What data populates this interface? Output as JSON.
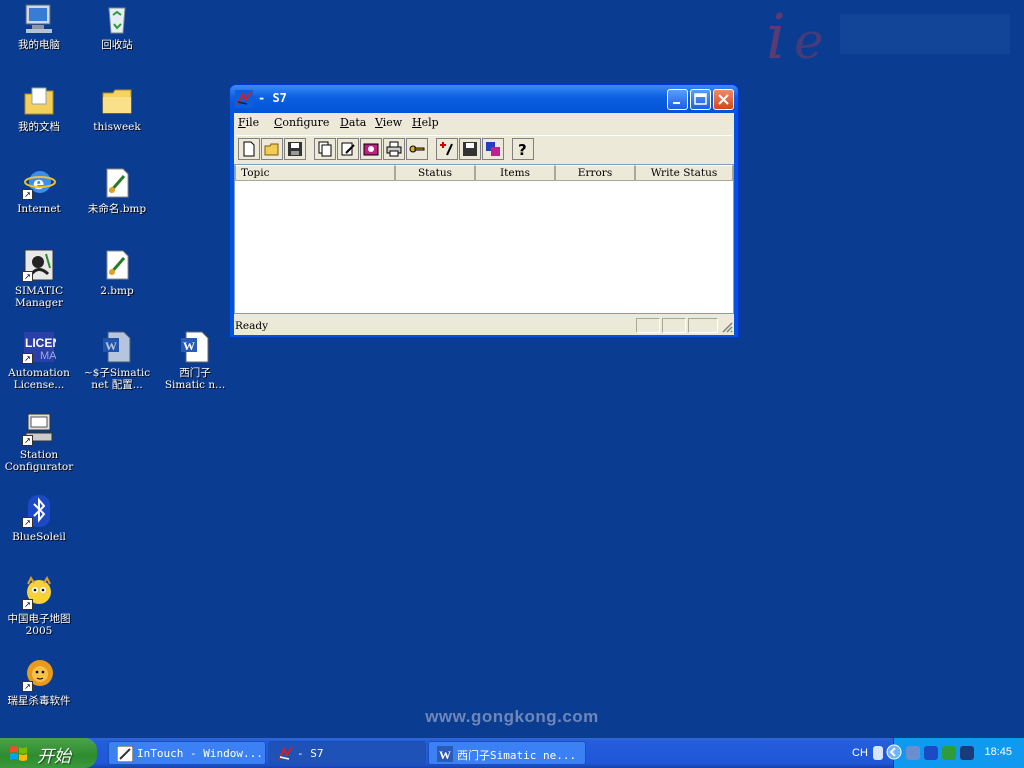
{
  "watermark": {
    "text": "www.gongkong.com"
  },
  "desktop": {
    "icons": [
      {
        "label": "我的电脑"
      },
      {
        "label": "回收站"
      },
      {
        "label": "我的文档"
      },
      {
        "label": "thisweek"
      },
      {
        "label": "Internet"
      },
      {
        "label": "未命名.bmp"
      },
      {
        "label": "SIMATIC\nManager"
      },
      {
        "label": "2.bmp"
      },
      {
        "label": "Automation\nLicense..."
      },
      {
        "label": "~$子Simatic\nnet 配置..."
      },
      {
        "label": "西门子\nSimatic n..."
      },
      {
        "label": "Station\nConfigurator"
      },
      {
        "label": "BlueSoleil"
      },
      {
        "label": "中国电子地图\n2005"
      },
      {
        "label": "瑞星杀毒软件"
      }
    ]
  },
  "window": {
    "title": "- S7",
    "menu": [
      {
        "key": "F",
        "rest": "ile"
      },
      {
        "key": "C",
        "rest": "onfigure"
      },
      {
        "key": "D",
        "rest": "ata"
      },
      {
        "key": "V",
        "rest": "iew"
      },
      {
        "key": "H",
        "rest": "elp"
      }
    ],
    "columns": [
      "Topic",
      "Status",
      "Items",
      "Errors",
      "Write Status"
    ],
    "status": "Ready"
  },
  "taskbar": {
    "start_label": "开始",
    "tasks": [
      {
        "label": "InTouch - Window..."
      },
      {
        "label": "- S7"
      },
      {
        "label": "西门子Simatic ne..."
      }
    ],
    "lang": "CH",
    "clock": "18:45"
  },
  "colors": {
    "desktop": "#0a3d91",
    "titlebar": "#0a5fe0",
    "start": "#2f8b2f",
    "tray": "#0f9aef"
  }
}
